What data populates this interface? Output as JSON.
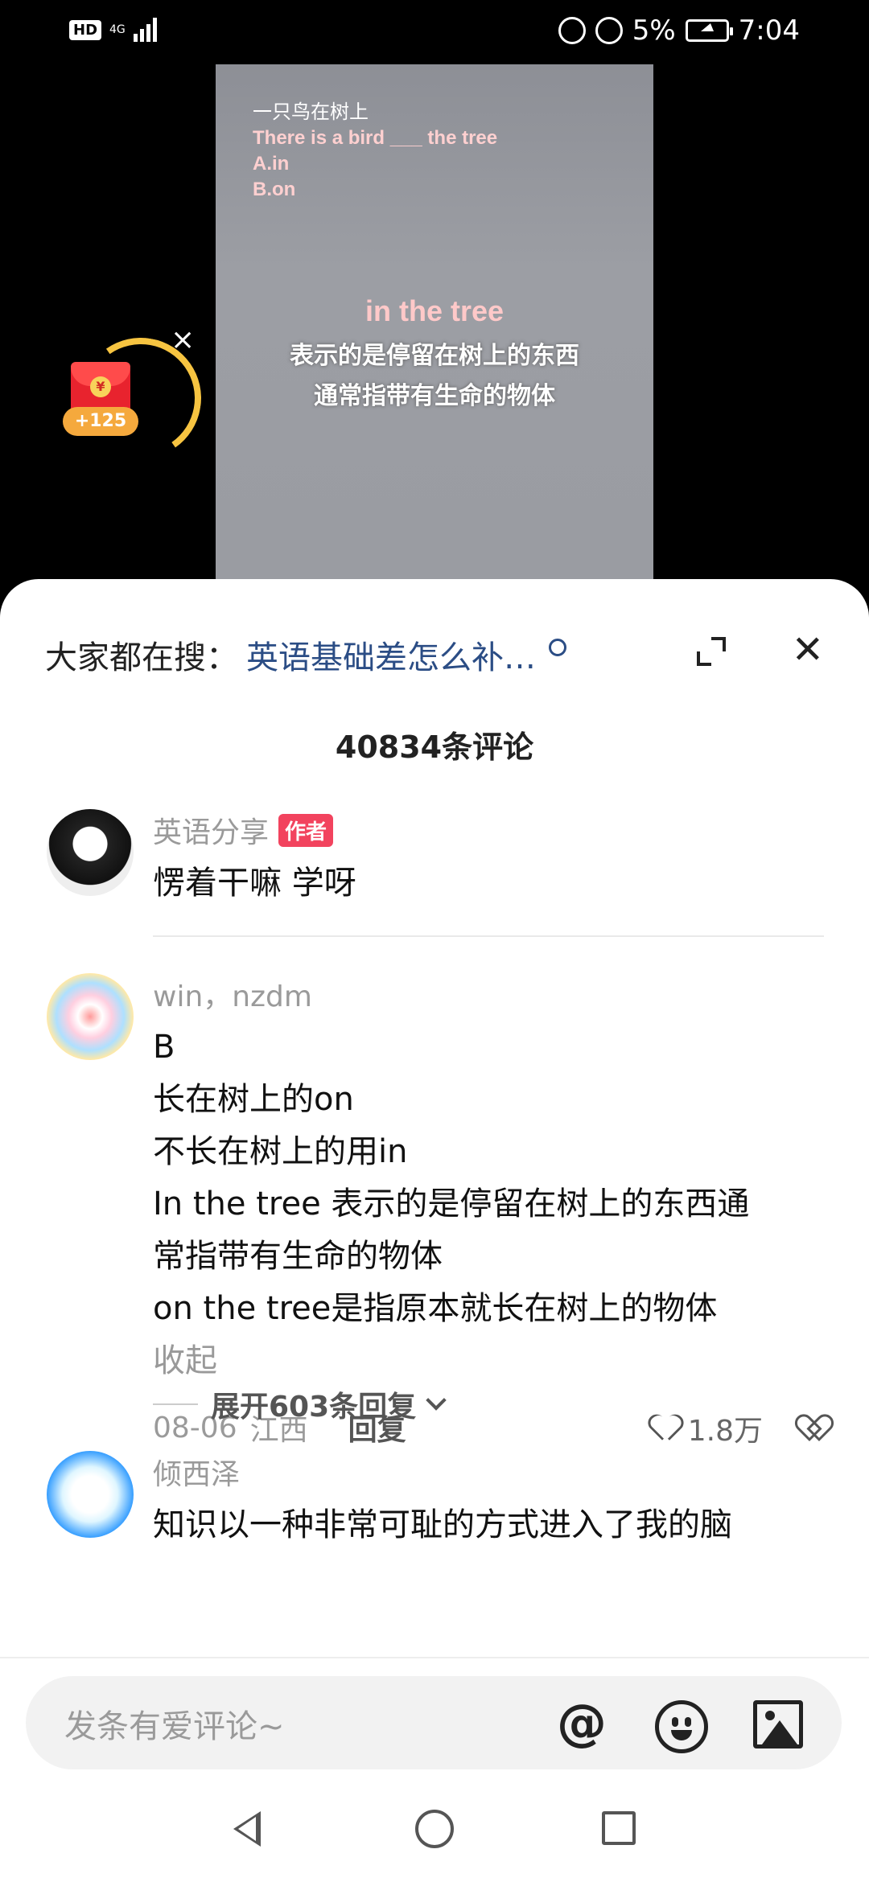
{
  "status_bar": {
    "hd": "HD",
    "network": "4G",
    "battery_percent": "5%",
    "time": "7:04"
  },
  "video": {
    "question_zh": "一只鸟在树上",
    "question_en": "There is a bird ___ the tree",
    "option_a": "A.in",
    "option_b": "B.on",
    "caption_title": "in the tree",
    "caption_line1": "表示的是停留在树上的东西",
    "caption_line2": "通常指带有生命的物体"
  },
  "reward": {
    "badge": "+125",
    "coin": "¥",
    "close": "×"
  },
  "sheet": {
    "search_label": "大家都在搜：",
    "search_term": "英语基础差怎么补…",
    "close_glyph": "✕",
    "comment_count": "40834条评论"
  },
  "comments": [
    {
      "name": "英语分享",
      "tag": "作者",
      "lines": [
        "愣着干嘛 学呀"
      ]
    },
    {
      "name": "win，nzdm",
      "lines": [
        "B",
        "长在树上的on",
        "不长在树上的用in",
        "In the tree 表示的是停留在树上的东西通",
        "常指带有生命的物体",
        "on the tree是指原本就长在树上的物体"
      ],
      "collapse": "收起",
      "date": "08-06",
      "location": "江西",
      "reply": "回复",
      "likes": "1.8万",
      "expand_replies": "展开603条回复"
    },
    {
      "name": "倾西泽",
      "lines": [
        "知识以一种非常可耻的方式进入了我的脑"
      ]
    }
  ],
  "input": {
    "placeholder": "发条有爱评论~",
    "at": "@"
  }
}
